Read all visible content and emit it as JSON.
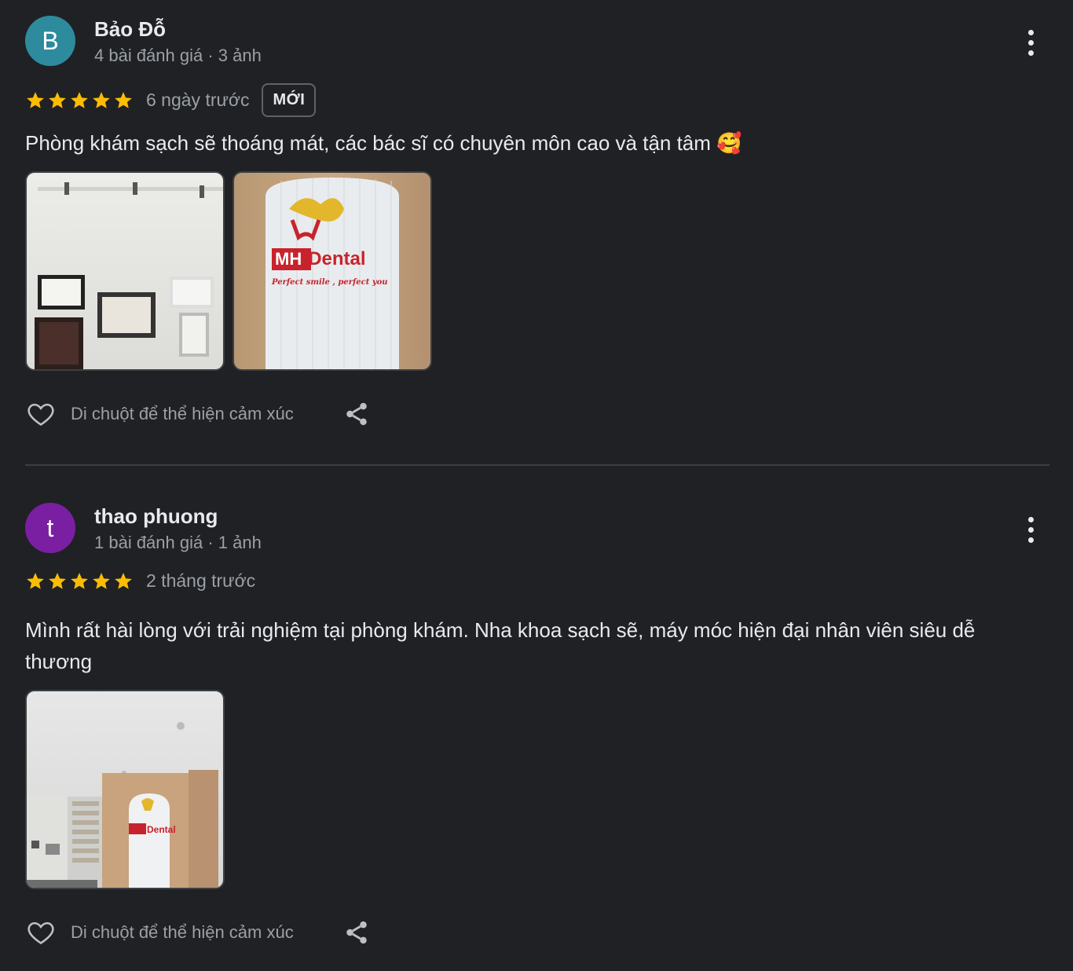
{
  "reviews": [
    {
      "avatar_letter": "B",
      "avatar_color": "#2e8b9e",
      "name": "Bảo Đỗ",
      "meta": "4 bài đánh giá · 3 ảnh",
      "rating": 5,
      "time": "6 ngày trước",
      "badge": "MỚI",
      "text": "Phòng khám sạch sẽ thoáng mát, các bác sĩ có chuyên môn cao và tận tâm 🥰",
      "react_label": "Di chuột để thể hiện cảm xúc"
    },
    {
      "avatar_letter": "t",
      "avatar_color": "#7b1fa2",
      "name": "thao phuong",
      "meta": "1 bài đánh giá · 1 ảnh",
      "rating": 5,
      "time": "2 tháng trước",
      "text": "Mình rất hài lòng với trải nghiệm tại phòng khám. Nha khoa sạch sẽ, máy móc hiện đại nhân viên siêu dễ thương",
      "react_label": "Di chuột để thể hiện cảm xúc"
    }
  ],
  "logo": {
    "brand_mh": "MH",
    "brand_dental": "Dental",
    "slogan": "Perfect smile , perfect you"
  },
  "colors": {
    "star": "#fbbc04",
    "background": "#202124",
    "secondary_text": "#9aa0a6",
    "brand_red": "#c8232c"
  },
  "icons": {
    "react": "heart-outline-icon",
    "share": "share-icon",
    "more": "more-vert-icon",
    "star": "star-icon"
  }
}
